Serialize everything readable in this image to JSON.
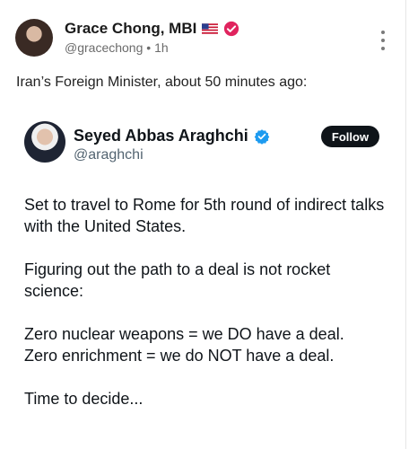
{
  "post": {
    "author": "Grace Chong, MBI",
    "handle": "@gracechong",
    "time": "1h",
    "text": "Iran’s Foreign Minister, about 50 minutes ago:"
  },
  "embed": {
    "name": "Seyed Abbas Araghchi",
    "handle": "@araghchi",
    "follow_label": "Follow",
    "paragraphs": [
      "Set to travel to Rome for 5th round of indirect talks with the United States.",
      "Figuring out the path to a deal is not rocket science:",
      "Zero nuclear weapons = we DO have a deal.",
      "Zero enrichment = we do NOT have a deal.",
      "Time to decide..."
    ]
  },
  "colors": {
    "follow_bg": "#0f1419",
    "verified_blue": "#1d9bf0",
    "badge_red": "#e0245e"
  },
  "icons": [
    "us-flag-icon",
    "verified-badge-icon",
    "more-options-icon"
  ]
}
